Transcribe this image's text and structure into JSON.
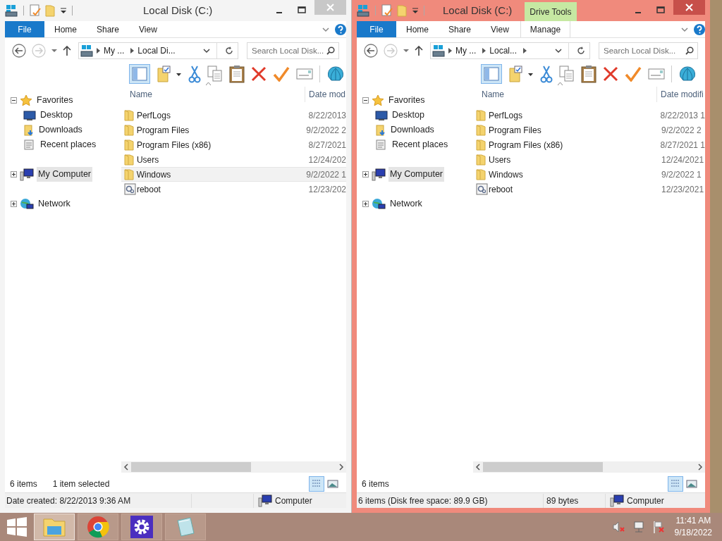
{
  "windows": [
    {
      "title": "Local Disk (C:)",
      "active": false,
      "ribbon_tabs": [
        {
          "label": "File",
          "kind": "menu"
        },
        {
          "label": "Home",
          "kind": "tab"
        },
        {
          "label": "Share",
          "kind": "tab"
        },
        {
          "label": "View",
          "kind": "tab"
        }
      ],
      "breadcrumb": [
        "My ...",
        "Local Di..."
      ],
      "breadcrumb_more": false,
      "search": {
        "placeholder": "Search Local Disk..."
      },
      "tree": [
        {
          "label": "Favorites",
          "kind": "favorites",
          "expanded": true,
          "selected": false,
          "children": [
            {
              "label": "Desktop",
              "kind": "desktop",
              "selected": false
            },
            {
              "label": "Downloads",
              "kind": "downloads",
              "selected": false
            },
            {
              "label": "Recent places",
              "kind": "recent",
              "selected": false
            }
          ]
        },
        {
          "label": "My Computer",
          "kind": "computer",
          "expanded": false,
          "selected": true
        },
        {
          "label": "Network",
          "kind": "network",
          "expanded": false,
          "selected": false
        }
      ],
      "columns": [
        "Name",
        "Date mod"
      ],
      "rows": [
        {
          "name": "PerfLogs",
          "date": "8/22/2013",
          "kind": "folder",
          "selected": false
        },
        {
          "name": "Program Files",
          "date": "9/2/2022 2",
          "kind": "folder",
          "selected": false
        },
        {
          "name": "Program Files (x86)",
          "date": "8/27/2021",
          "kind": "folder",
          "selected": false
        },
        {
          "name": "Users",
          "date": "12/24/202",
          "kind": "folder",
          "selected": false
        },
        {
          "name": "Windows",
          "date": "9/2/2022 1",
          "kind": "folder",
          "selected": true
        },
        {
          "name": "reboot",
          "date": "12/23/202",
          "kind": "script",
          "selected": false
        }
      ],
      "item_count": "6 items",
      "selection_info": "1 item selected",
      "status_bar": {
        "info": "Date created: 8/22/2013 9:36 AM",
        "zone": "Computer"
      }
    },
    {
      "title": "Local Disk (C:)",
      "active": true,
      "contextual_group": "Drive Tools",
      "ribbon_tabs": [
        {
          "label": "File",
          "kind": "menu"
        },
        {
          "label": "Home",
          "kind": "tab"
        },
        {
          "label": "Share",
          "kind": "tab"
        },
        {
          "label": "View",
          "kind": "tab"
        },
        {
          "label": "Manage",
          "kind": "contextual"
        }
      ],
      "breadcrumb": [
        "My ...",
        "Local..."
      ],
      "breadcrumb_more": true,
      "search": {
        "placeholder": "Search Local Disk..."
      },
      "tree": [
        {
          "label": "Favorites",
          "kind": "favorites",
          "expanded": true,
          "selected": false,
          "children": [
            {
              "label": "Desktop",
              "kind": "desktop",
              "selected": false
            },
            {
              "label": "Downloads",
              "kind": "downloads",
              "selected": false
            },
            {
              "label": "Recent places",
              "kind": "recent",
              "selected": false
            }
          ]
        },
        {
          "label": "My Computer",
          "kind": "computer",
          "expanded": false,
          "selected": true
        },
        {
          "label": "Network",
          "kind": "network",
          "expanded": false,
          "selected": false
        }
      ],
      "columns": [
        "Name",
        "Date modifi"
      ],
      "rows": [
        {
          "name": "PerfLogs",
          "date": "8/22/2013 1",
          "kind": "folder",
          "selected": false
        },
        {
          "name": "Program Files",
          "date": "9/2/2022 2",
          "kind": "folder",
          "selected": false
        },
        {
          "name": "Program Files (x86)",
          "date": "8/27/2021 1",
          "kind": "folder",
          "selected": false
        },
        {
          "name": "Users",
          "date": "12/24/2021",
          "kind": "folder",
          "selected": false
        },
        {
          "name": "Windows",
          "date": "9/2/2022 1",
          "kind": "folder",
          "selected": false
        },
        {
          "name": "reboot",
          "date": "12/23/2021",
          "kind": "script",
          "selected": false
        }
      ],
      "item_count": "6 items",
      "status_bar": {
        "info": "6 items (Disk free space: 89.9 GB)",
        "size": "89 bytes",
        "zone": "Computer"
      }
    }
  ],
  "taskbar": {
    "apps": [
      {
        "kind": "explorer",
        "selected": true
      },
      {
        "kind": "chrome",
        "selected": false
      },
      {
        "kind": "settings",
        "selected": false
      },
      {
        "kind": "notepad",
        "selected": false
      }
    ],
    "clock": {
      "time": "11:41 AM",
      "date": "9/18/2022"
    }
  }
}
